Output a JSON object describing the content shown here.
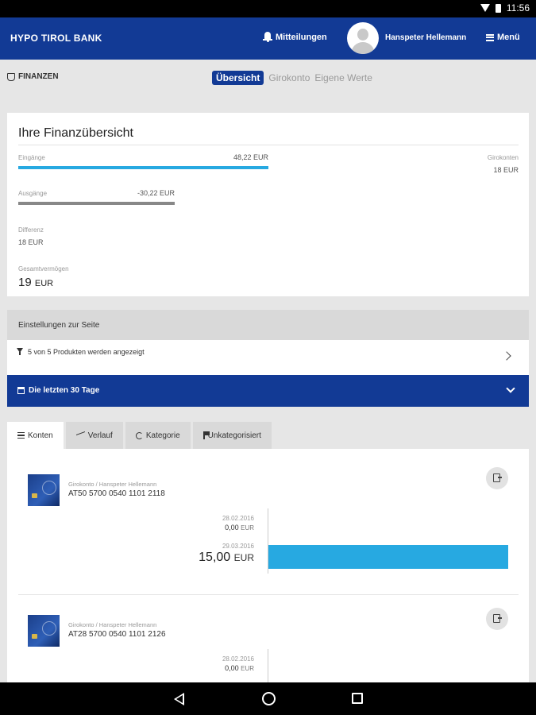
{
  "status": {
    "time": "11:56"
  },
  "header": {
    "brand": "HYPO TIROL BANK",
    "notifications_label": "Mitteilungen",
    "user_name": "Hanspeter Hellemann",
    "menu_label": "Menü"
  },
  "section": {
    "title": "FINANZEN",
    "subtabs": [
      "Übersicht",
      "Girokonto",
      "Eigene Werte"
    ],
    "active_subtab": "Übersicht"
  },
  "overview": {
    "title": "Ihre Finanzübersicht",
    "income_label": "Eingänge",
    "income_value": "48,22 EUR",
    "income_fraction": 1.0,
    "expense_label": "Ausgänge",
    "expense_value": "-30,22 EUR",
    "expense_fraction": 0.63,
    "difference_label": "Differenz",
    "difference_value": "18 EUR",
    "total_label": "Gesamtvermögen",
    "total_amount": "19",
    "total_currency": "EUR",
    "giro_label": "Girokonten",
    "giro_value": "18 EUR"
  },
  "settings": {
    "header": "Einstellungen zur Seite",
    "products_text": "5 von 5 Produkten werden angezeigt",
    "period_text": "Die letzten 30 Tage"
  },
  "tabs": [
    "Konten",
    "Verlauf",
    "Kategorie",
    "Unkategorisiert"
  ],
  "accounts": [
    {
      "name": "Girokonto / Hanspeter Hellemann",
      "iban": "AT50 5700 0540 1101 2118",
      "date1": "28.02.2016",
      "value1": "0,00",
      "value1_currency": "EUR",
      "date2": "29.03.2016",
      "value2": "15,00",
      "value2_currency": "EUR",
      "bar_fraction": 1.0
    },
    {
      "name": "Girokonto / Hanspeter Hellemann",
      "iban": "AT28 5700 0540 1101 2126",
      "date1": "28.02.2016",
      "value1": "0,00",
      "value1_currency": "EUR"
    }
  ],
  "colors": {
    "primary": "#123a95",
    "accent": "#27a9e1",
    "background": "#e6e6e6"
  }
}
